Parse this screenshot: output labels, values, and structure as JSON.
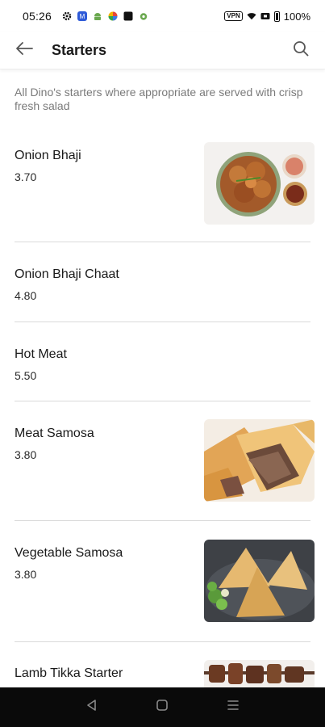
{
  "status": {
    "time": "05:26",
    "vpn": "VPN",
    "battery_text": "100%"
  },
  "header": {
    "title": "Starters",
    "back_icon": "arrow-left-icon",
    "search_icon": "search-icon"
  },
  "intro": "All Dino's starters where appropriate are served with crisp fresh salad",
  "items": [
    {
      "name": "Onion Bhaji",
      "price": "3.70",
      "image": "onion-bhaji-photo"
    },
    {
      "name": "Onion Bhaji Chaat",
      "price": "4.80",
      "image": null
    },
    {
      "name": "Hot Meat",
      "price": "5.50",
      "image": null
    },
    {
      "name": "Meat Samosa",
      "price": "3.80",
      "image": "meat-samosa-photo"
    },
    {
      "name": "Vegetable Samosa",
      "price": "3.80",
      "image": "vegetable-samosa-photo"
    },
    {
      "name": "Lamb Tikka Starter",
      "price": "",
      "image": "lamb-tikka-photo"
    }
  ],
  "colors": {
    "divider": "#dadada",
    "nav_bar": "#0a0a0a",
    "intro_text": "#7a7a7a"
  }
}
